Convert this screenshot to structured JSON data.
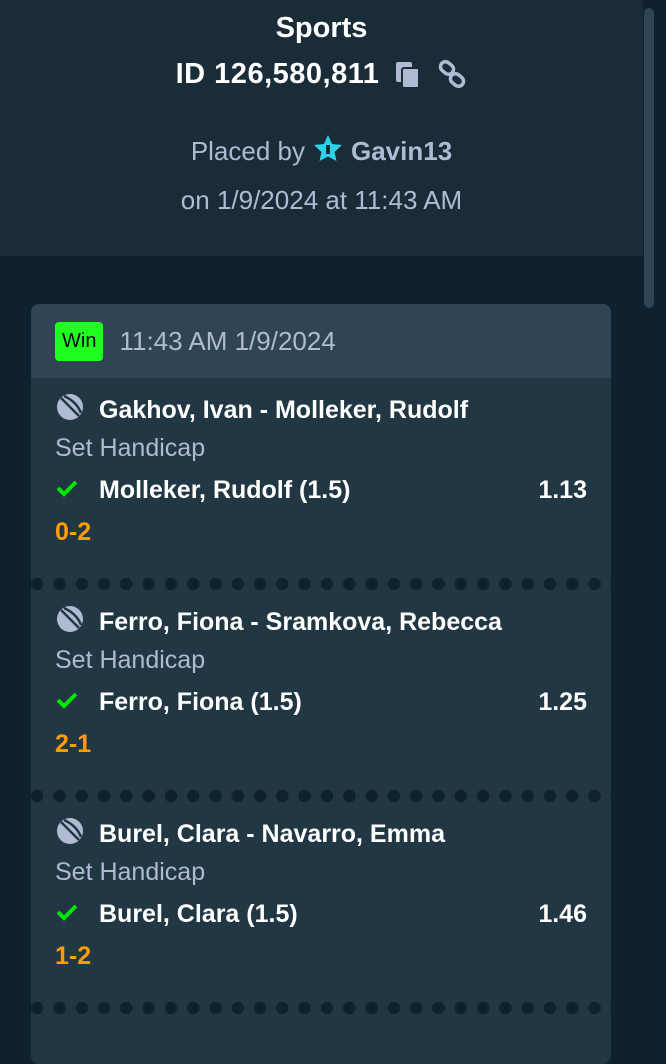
{
  "header": {
    "title": "Sports",
    "bet_id": "ID 126,580,811",
    "placed_by_prefix": "Placed by",
    "user": "Gavin13",
    "placed_on": "on 1/9/2024 at 11:43 AM",
    "icons": {
      "copy": "copy-icon",
      "link": "link-icon",
      "vip": "vip-star-icon"
    }
  },
  "bet": {
    "status": "Win",
    "time": "11:43 AM 1/9/2024",
    "legs": [
      {
        "event": "Gakhov, Ivan - Molleker, Rudolf",
        "market": "Set Handicap",
        "selection": "Molleker, Rudolf (1.5)",
        "odds": "1.13",
        "score": "0-2"
      },
      {
        "event": "Ferro, Fiona - Sramkova, Rebecca",
        "market": "Set Handicap",
        "selection": "Ferro, Fiona (1.5)",
        "odds": "1.25",
        "score": "2-1"
      },
      {
        "event": "Burel, Clara - Navarro, Emma",
        "market": "Set Handicap",
        "selection": "Burel, Clara (1.5)",
        "odds": "1.46",
        "score": "1-2"
      }
    ]
  },
  "colors": {
    "background": "#0f212e",
    "panel": "#1a2c38",
    "card": "#213743",
    "card_header": "#2f4553",
    "win": "#1fff20",
    "score": "#ff9d00",
    "check": "#00e701",
    "muted_text": "#b1bad3"
  }
}
